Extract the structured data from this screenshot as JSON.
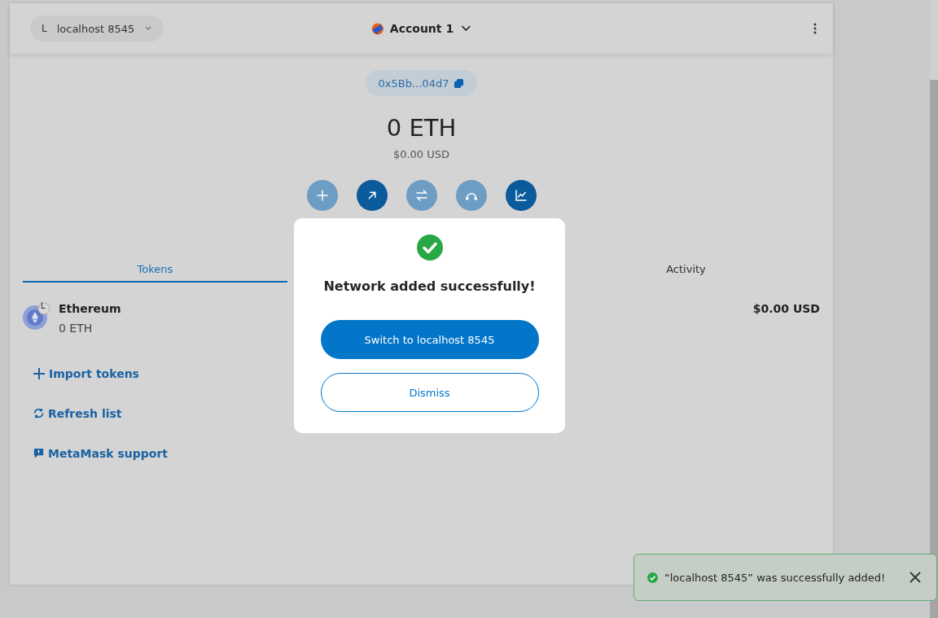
{
  "header": {
    "network": {
      "initial": "L",
      "name": "localhost 8545"
    },
    "account": "Account 1"
  },
  "address": "0x5Bb...04d7",
  "balance": {
    "primary": "0 ETH",
    "secondary": "$0.00 USD"
  },
  "actions": [
    {
      "kind": "buy",
      "disabled": true
    },
    {
      "kind": "send",
      "disabled": false
    },
    {
      "kind": "swap",
      "disabled": true
    },
    {
      "kind": "bridge",
      "disabled": true
    },
    {
      "kind": "portfolio",
      "disabled": false
    }
  ],
  "tabs": [
    {
      "label": "Tokens",
      "selected": true
    },
    {
      "label": "Activity",
      "selected": false
    }
  ],
  "tokens": [
    {
      "name": "Ethereum",
      "badge": "L",
      "amount": "0 ETH",
      "value": "$0.00 USD"
    }
  ],
  "links": [
    {
      "kind": "import",
      "label": "Import tokens"
    },
    {
      "kind": "refresh",
      "label": "Refresh list"
    },
    {
      "kind": "support",
      "label": "MetaMask support"
    }
  ],
  "modal": {
    "title": "Network added successfully!",
    "primary_button": "Switch to localhost 8545",
    "secondary_button": "Dismiss"
  },
  "toast": {
    "message": "“localhost 8545” was successfully added!"
  }
}
